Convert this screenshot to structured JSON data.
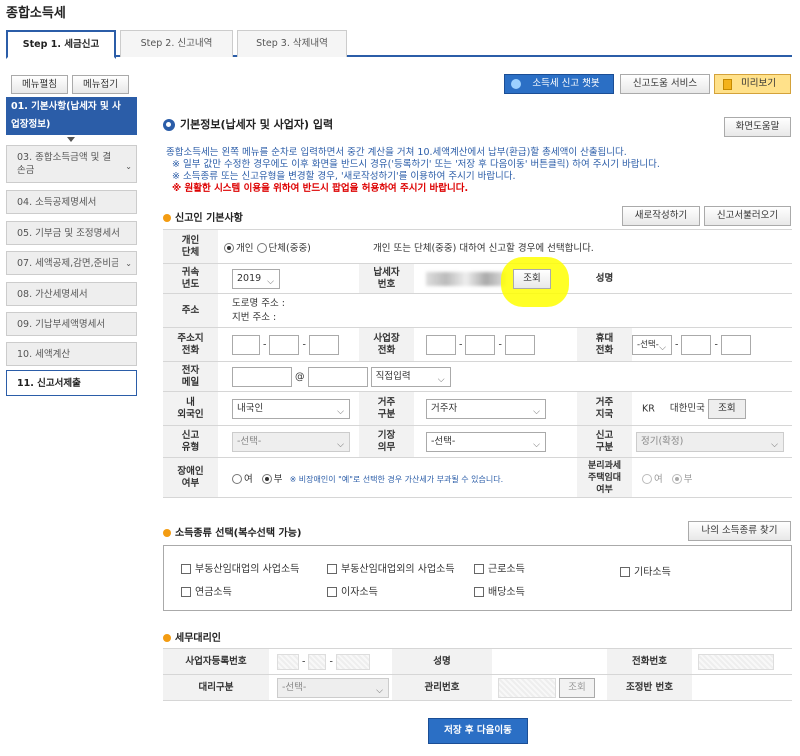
{
  "page_title": "종합소득세",
  "tabs": [
    {
      "label": "Step 1. 세금신고"
    },
    {
      "label": "Step 2. 신고내역"
    },
    {
      "label": "Step 3. 삭제내역"
    }
  ],
  "menu": {
    "expand_label": "메뉴펼침",
    "collapse_label": "메뉴접기"
  },
  "sidebar": [
    {
      "label": "01. 기본사항(납세자 및 사업장정보)"
    },
    {
      "label": "03. 종합소득금액 및 결손금"
    },
    {
      "label": "04. 소득공제명세서"
    },
    {
      "label": "05. 기부금 및 조정명세서"
    },
    {
      "label": "07. 세액공제,감면,준비금"
    },
    {
      "label": "08. 가산세명세서"
    },
    {
      "label": "09. 기납부세액명세서"
    },
    {
      "label": "10. 세액계산"
    },
    {
      "label": "11. 신고서제출"
    }
  ],
  "top_buttons": {
    "chatbot": "소득세 신고 챗봇",
    "help_service": "신고도움 서비스",
    "preview": "미리보기"
  },
  "section_basic": {
    "title": "기본정보(납세자 및 사업자) 입력",
    "screen_help": "화면도움말",
    "notes": [
      "종합소득세는 왼쪽 메뉴를 순차로 입력하면서 중간 계산을 거쳐 10.세액계산에서 납부(환급)할 총세액이 산출됩니다.",
      "※ 일부 값만 수정한 경우에도 이후 화면을 반드시 경유('등록하기' 또는 '저장 후 다음이동' 버튼클릭) 하여 주시기 바랍니다.",
      "※ 소득종류 또는 신고유형을 변경할 경우, '새로작성하기'를 이용하여 주시기 바랍니다.",
      "※ 원활한 시스템 이용을 위하여 반드시 팝업을 허용하여 주시기 바랍니다."
    ]
  },
  "reporter": {
    "title": "신고인 기본사항",
    "new_write": "새로작성하기",
    "load": "신고서불러오기",
    "labels": {
      "individual": "개인\n단체",
      "year": "귀속\n년도",
      "taxpayer_no": "납세자\n번호",
      "name": "성명",
      "address": "주소",
      "home_phone": "주소지\n전화",
      "biz_phone": "사업장\n전화",
      "mobile": "휴대\n전화",
      "email": "전자\n메일",
      "resident": "내\n외국인",
      "residence": "거주\n구분",
      "country": "거주\n지국",
      "report_type": "신고\n유형",
      "bookkeeping": "기장\n의무",
      "report_class": "신고\n구분",
      "disabled": "장애인\n여부",
      "separate": "분리과세\n주택임대\n여부"
    },
    "individual_opt": "개인",
    "group_opt": "단체(중중)",
    "individual_hint": "개인 또는 단체(중중) 대하여 신고할 경우에 선택합니다.",
    "year_value": "2019",
    "lookup": "조회",
    "road_address": "도로명 주소 :",
    "lot_address": "지번 주소 :",
    "mobile_select": "-선택-",
    "email_at": "@",
    "email_domain": "직접입력",
    "resident_value": "내국인",
    "residence_value": "거주자",
    "country_code": "KR",
    "country_name": "대한민국",
    "report_type_value": "-선택-",
    "bookkeeping_value": "-선택-",
    "report_class_value": "정기(확정)",
    "yes": "여",
    "no": "부",
    "disabled_note": "※ 비장애인이 \"예\"로 선택한 경우 가산세가 부과될 수 있습니다."
  },
  "income": {
    "title": "소득종류 선택(복수선택 가능)",
    "find_button": "나의 소득종류 찾기",
    "items": [
      "부동산임대업의 사업소득",
      "부동산임대업외의 사업소득",
      "근로소득",
      "기타소득",
      "연금소득",
      "이자소득",
      "배당소득"
    ]
  },
  "agent": {
    "title": "세무대리인",
    "biz_no": "사업자등록번호",
    "name": "성명",
    "phone": "전화번호",
    "agent_type": "대리구분",
    "agent_type_value": "-선택-",
    "manage_no": "관리번호",
    "lookup": "조회",
    "adjust_no": "조정반 번호"
  },
  "save_next": "저장 후 다음이동",
  "colors": {
    "primary": "#2b5da8",
    "highlight": "#ffff00",
    "warning": "#dd0000"
  }
}
